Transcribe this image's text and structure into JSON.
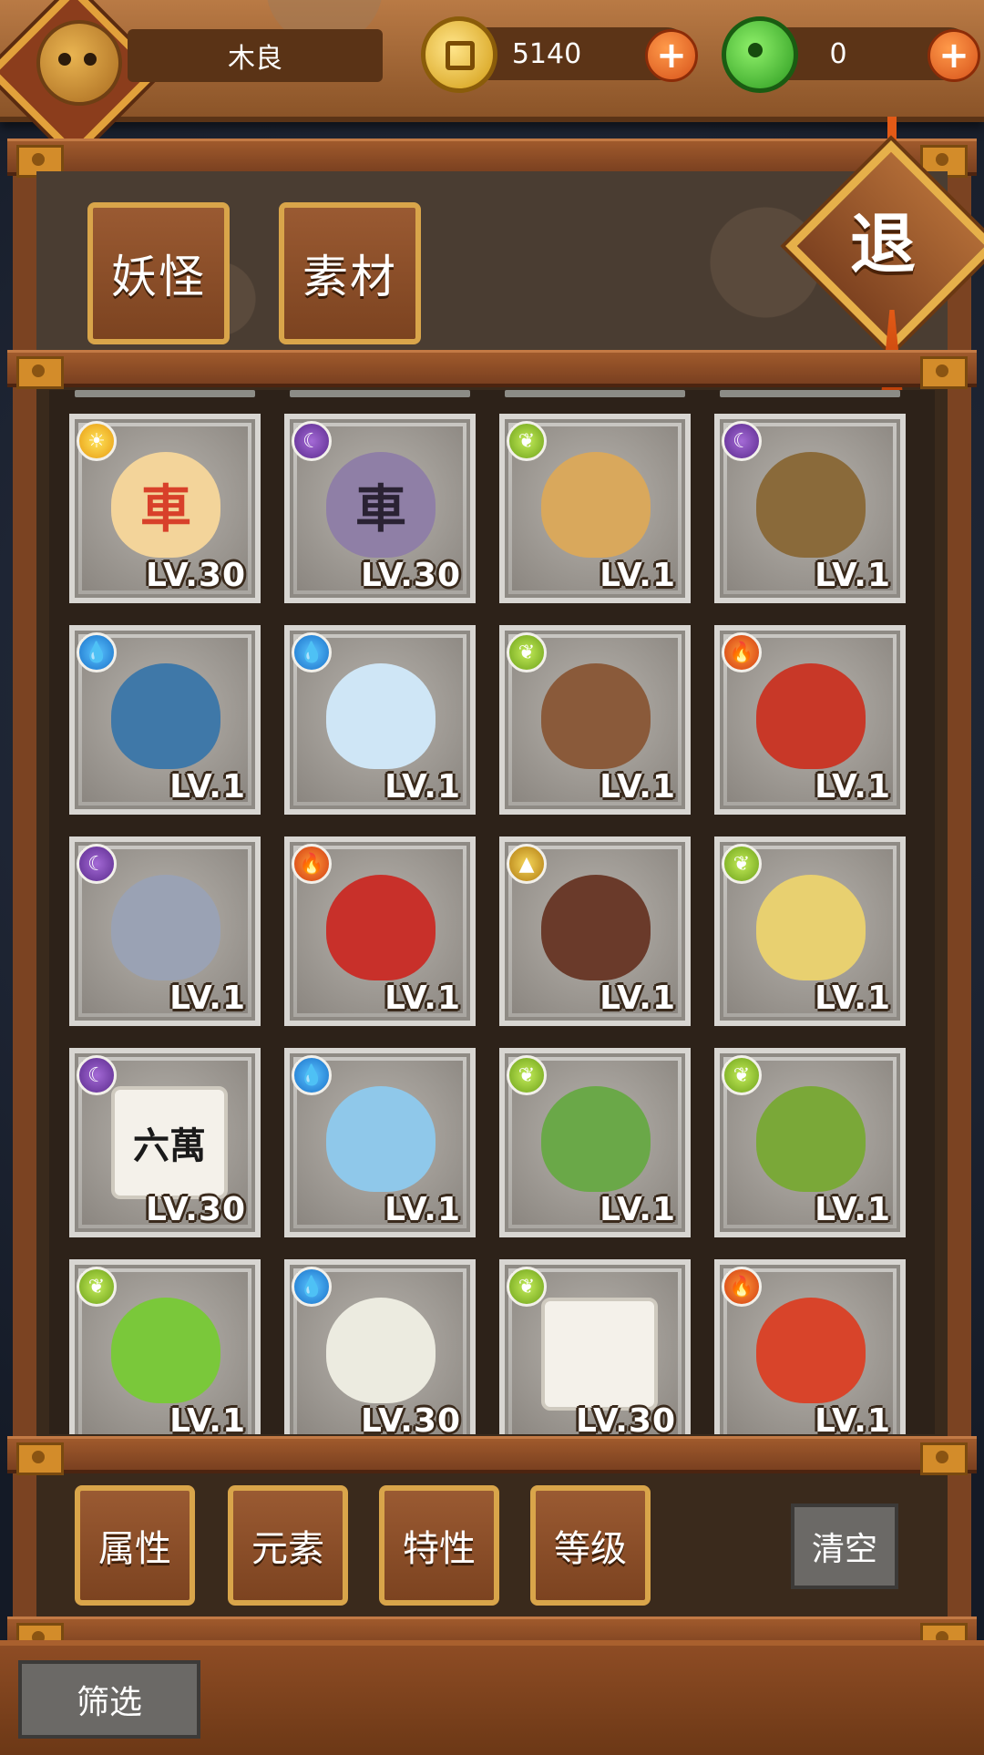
{
  "header": {
    "player_name": "木良",
    "gold": "5140",
    "jade": "0"
  },
  "tabs": [
    {
      "label": "妖怪"
    },
    {
      "label": "素材"
    }
  ],
  "exit_label": "退",
  "cards": [
    {
      "element": "sun",
      "icon": "chess-chariot-red",
      "glyph": "車",
      "level": "LV.30"
    },
    {
      "element": "moon",
      "icon": "chess-chariot-purple",
      "glyph": "車",
      "level": "LV.30"
    },
    {
      "element": "leaf",
      "icon": "wooden-doll",
      "glyph": "",
      "level": "LV.1"
    },
    {
      "element": "moon",
      "icon": "ghost-well",
      "glyph": "",
      "level": "LV.1"
    },
    {
      "element": "water",
      "icon": "blue-warrior",
      "glyph": "",
      "level": "LV.1"
    },
    {
      "element": "water",
      "icon": "cloud-spirit",
      "glyph": "",
      "level": "LV.1"
    },
    {
      "element": "leaf",
      "icon": "wood-stump",
      "glyph": "",
      "level": "LV.1"
    },
    {
      "element": "fire",
      "icon": "red-hair-spirit",
      "glyph": "",
      "level": "LV.1"
    },
    {
      "element": "moon",
      "icon": "fish",
      "glyph": "",
      "level": "LV.1"
    },
    {
      "element": "fire",
      "icon": "red-coral",
      "glyph": "",
      "level": "LV.1"
    },
    {
      "element": "earth",
      "icon": "mud-creatures",
      "glyph": "",
      "level": "LV.1"
    },
    {
      "element": "leaf",
      "icon": "twin-spirits",
      "glyph": "",
      "level": "LV.1"
    },
    {
      "element": "moon",
      "icon": "mahjong-tile-six",
      "glyph": "六萬",
      "level": "LV.30"
    },
    {
      "element": "water",
      "icon": "water-vase",
      "glyph": "",
      "level": "LV.1"
    },
    {
      "element": "leaf",
      "icon": "leek-wizard",
      "glyph": "",
      "level": "LV.1"
    },
    {
      "element": "leaf",
      "icon": "bamboo-scroll",
      "glyph": "",
      "level": "LV.1"
    },
    {
      "element": "leaf",
      "icon": "green-fruit",
      "glyph": "",
      "level": "LV.1"
    },
    {
      "element": "water",
      "icon": "radish-spirit",
      "glyph": "",
      "level": "LV.30"
    },
    {
      "element": "leaf",
      "icon": "mahjong-tile-dots",
      "glyph": "",
      "level": "LV.30"
    },
    {
      "element": "fire",
      "icon": "drum-spirit",
      "glyph": "",
      "level": "LV.1"
    }
  ],
  "filters": [
    {
      "label": "属性"
    },
    {
      "label": "元素"
    },
    {
      "label": "特性"
    },
    {
      "label": "等级"
    }
  ],
  "clear_label": "清空",
  "screen_label": "筛选",
  "colors": {
    "wood": "#7b4322",
    "gold_trim": "#d9a54a",
    "card_bg": "#a9a6a1"
  }
}
